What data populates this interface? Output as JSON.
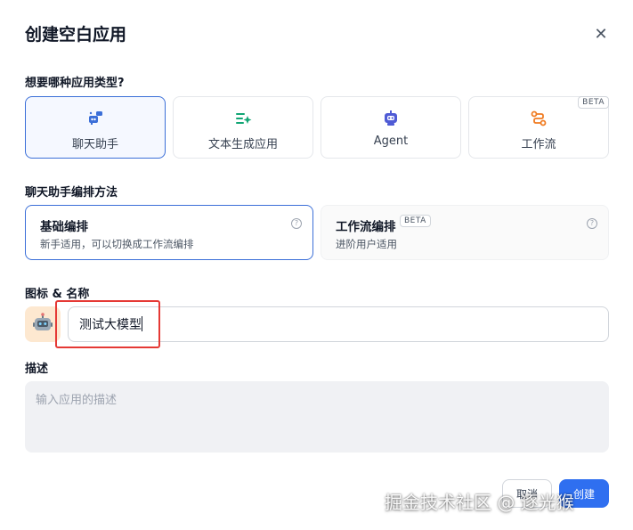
{
  "dialog": {
    "title": "创建空白应用",
    "close_icon": "close-icon"
  },
  "app_type": {
    "label": "想要哪种应用类型?",
    "options": [
      {
        "label": "聊天助手",
        "icon": "chat-bot-icon",
        "selected": true,
        "color": "#3b6fd8"
      },
      {
        "label": "文本生成应用",
        "icon": "text-generation-icon",
        "selected": false,
        "color": "#12a675"
      },
      {
        "label": "Agent",
        "icon": "agent-robot-icon",
        "selected": false,
        "color": "#4f5bd5"
      },
      {
        "label": "工作流",
        "icon": "workflow-icon",
        "selected": false,
        "badge": "BETA",
        "color": "#f07c22"
      }
    ]
  },
  "orchestration": {
    "label": "聊天助手编排方法",
    "options": [
      {
        "title": "基础编排",
        "desc": "新手适用，可以切换成工作流编排",
        "selected": true
      },
      {
        "title": "工作流编排",
        "badge": "BETA",
        "desc": "进阶用户适用",
        "selected": false
      }
    ]
  },
  "icon_name": {
    "label": "图标 & 名称",
    "avatar_icon": "robot-emoji-icon",
    "name_value": "测试大模型"
  },
  "description": {
    "label": "描述",
    "placeholder": "输入应用的描述"
  },
  "footer": {
    "cancel_label": "取消",
    "create_label": "创建"
  },
  "watermark": "掘金技术社区 @ 逐光猴"
}
